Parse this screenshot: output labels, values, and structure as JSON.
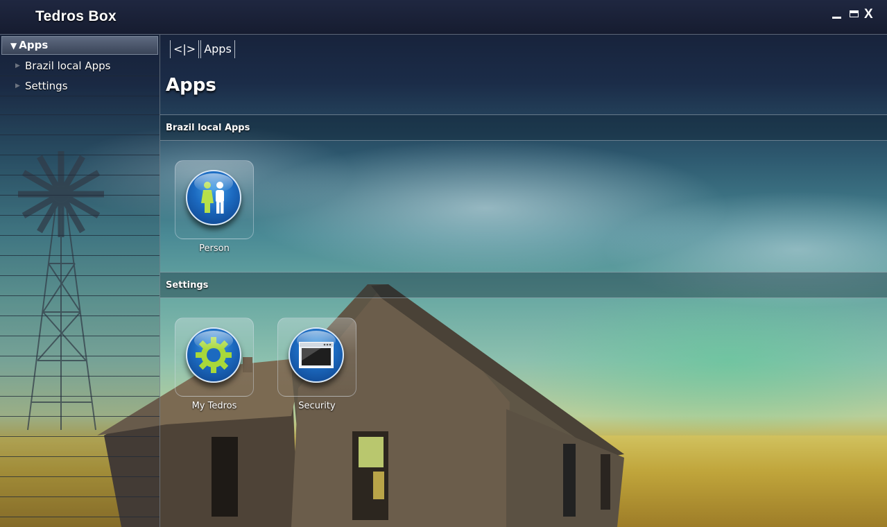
{
  "window": {
    "title": "Tedros Box",
    "controls": {
      "minimize": "minimize",
      "maximize": "maximize",
      "close": "X"
    }
  },
  "sidebar": {
    "header": "Apps",
    "items": [
      {
        "label": "Brazil local Apps",
        "icon": "triangle-right-icon"
      },
      {
        "label": "Settings",
        "icon": "triangle-right-icon"
      }
    ]
  },
  "main": {
    "breadcrumb": [
      "<|>",
      "Apps"
    ],
    "title": "Apps",
    "sections": [
      {
        "header": "Brazil local Apps",
        "apps": [
          {
            "label": "Person",
            "icon": "person-icon"
          }
        ]
      },
      {
        "header": "Settings",
        "apps": [
          {
            "label": "My Tedros",
            "icon": "gear-icon"
          },
          {
            "label": "Security",
            "icon": "window-icon"
          }
        ]
      }
    ]
  },
  "colors": {
    "orb_blue": "#1c6ac0",
    "titlebar": "#1a2035",
    "field": "#c0a53b"
  }
}
